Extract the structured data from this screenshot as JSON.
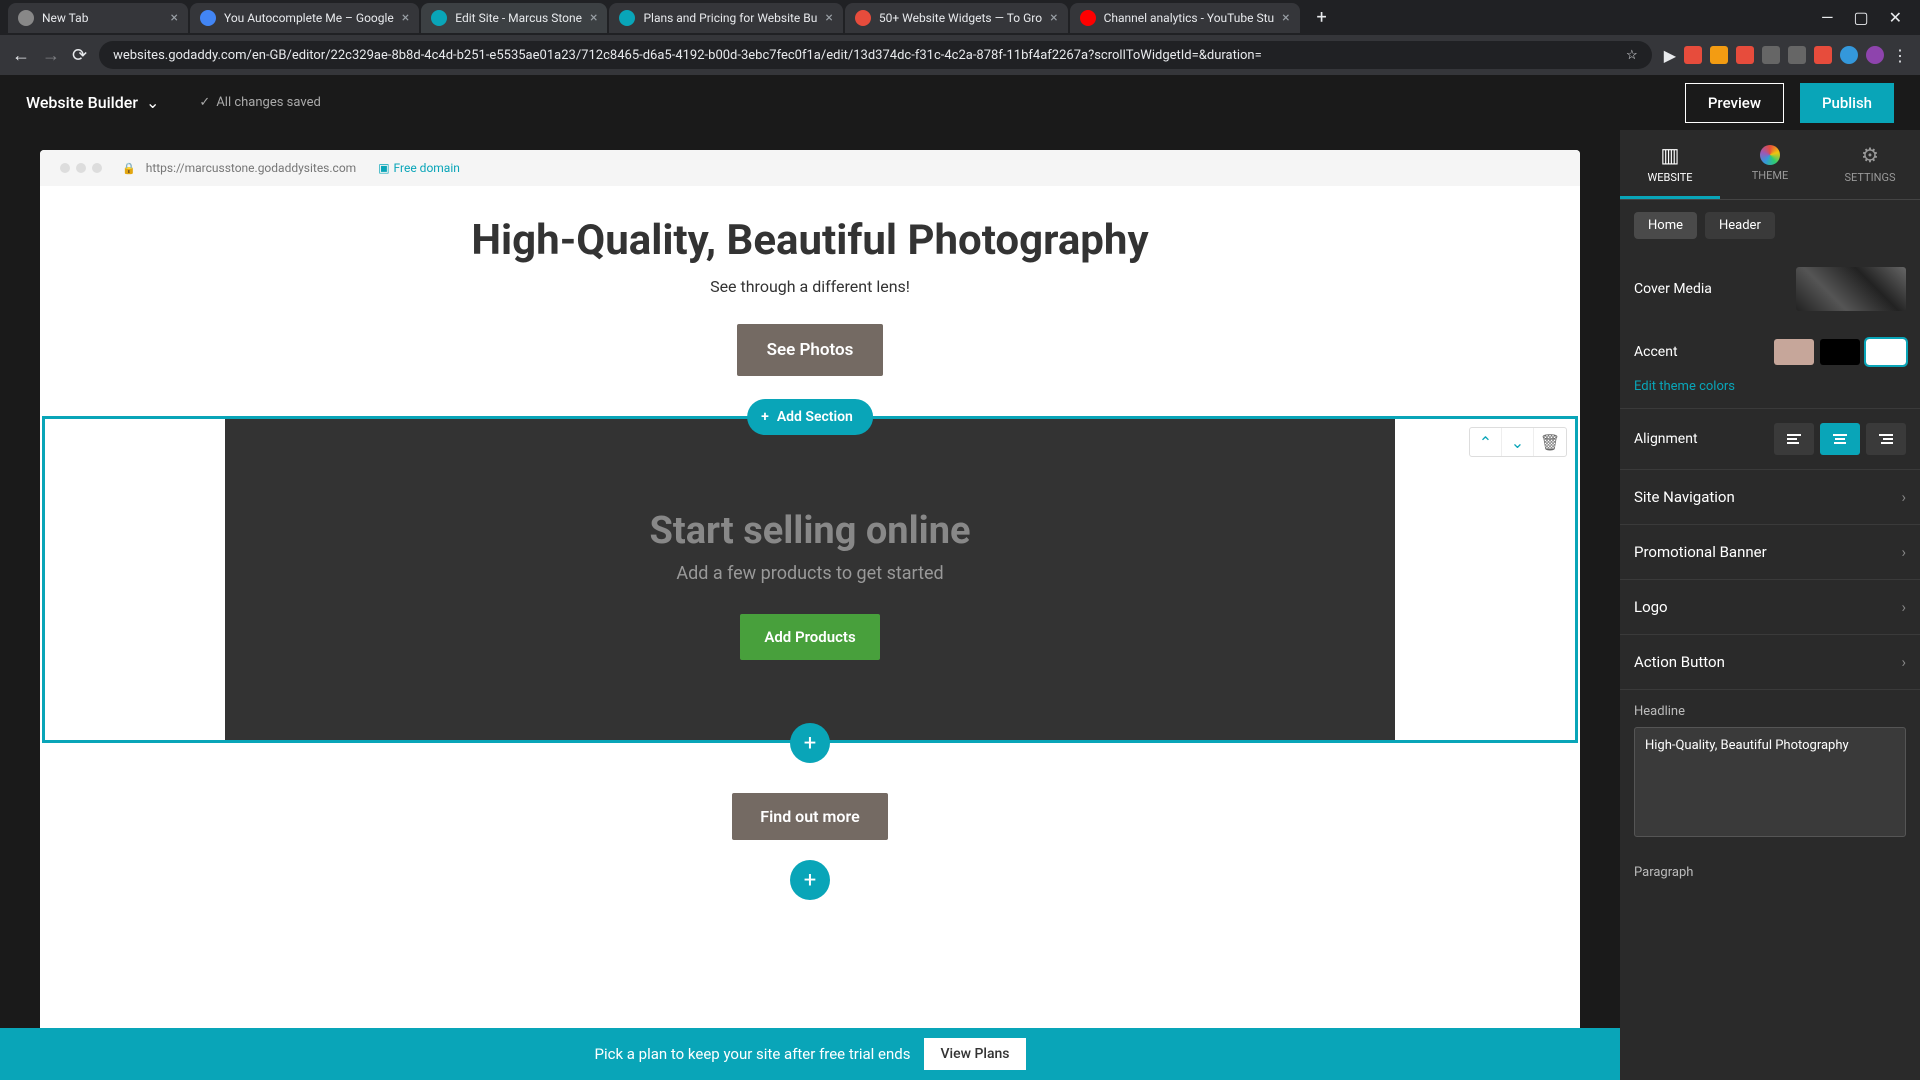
{
  "browser": {
    "tabs": [
      {
        "title": "New Tab"
      },
      {
        "title": "You Autocomplete Me – Google"
      },
      {
        "title": "Edit Site - Marcus Stone"
      },
      {
        "title": "Plans and Pricing for Website Bu"
      },
      {
        "title": "50+ Website Widgets — To Gro"
      },
      {
        "title": "Channel analytics - YouTube Stu"
      }
    ],
    "url": "websites.godaddy.com/en-GB/editor/22c329ae-8b8d-4c4d-b251-e5535ae01a23/712c8465-d6a5-4192-b00d-3ebc7fec0f1a/edit/13d374dc-f31c-4c2a-878f-11bf4af2267a?scrollToWidgetId=&duration="
  },
  "appbar": {
    "title": "Website Builder",
    "saved": "All changes saved",
    "preview": "Preview",
    "publish": "Publish"
  },
  "canvas": {
    "site_url": "https://marcusstone.godaddysites.com",
    "free_domain": "Free domain",
    "hero": {
      "title": "High-Quality, Beautiful Photography",
      "subtitle": "See through a different lens!",
      "button": "See Photos"
    },
    "add_section": "Add Section",
    "sell": {
      "title": "Start selling online",
      "subtitle": "Add a few products to get started",
      "button": "Add Products"
    },
    "find_more": "Find out more"
  },
  "panel": {
    "tabs": {
      "website": "WEBSITE",
      "theme": "THEME",
      "settings": "SETTINGS"
    },
    "subtabs": {
      "home": "Home",
      "header": "Header"
    },
    "cover_media": "Cover Media",
    "accent": "Accent",
    "edit_colors": "Edit theme colors",
    "alignment": "Alignment",
    "nav": "Site Navigation",
    "promo": "Promotional Banner",
    "logo": "Logo",
    "action": "Action Button",
    "headline_label": "Headline",
    "headline_value": "High-Quality, Beautiful Photography",
    "paragraph_label": "Paragraph"
  },
  "banner": {
    "text": "Pick a plan to keep your site after free trial ends",
    "button": "View Plans"
  }
}
